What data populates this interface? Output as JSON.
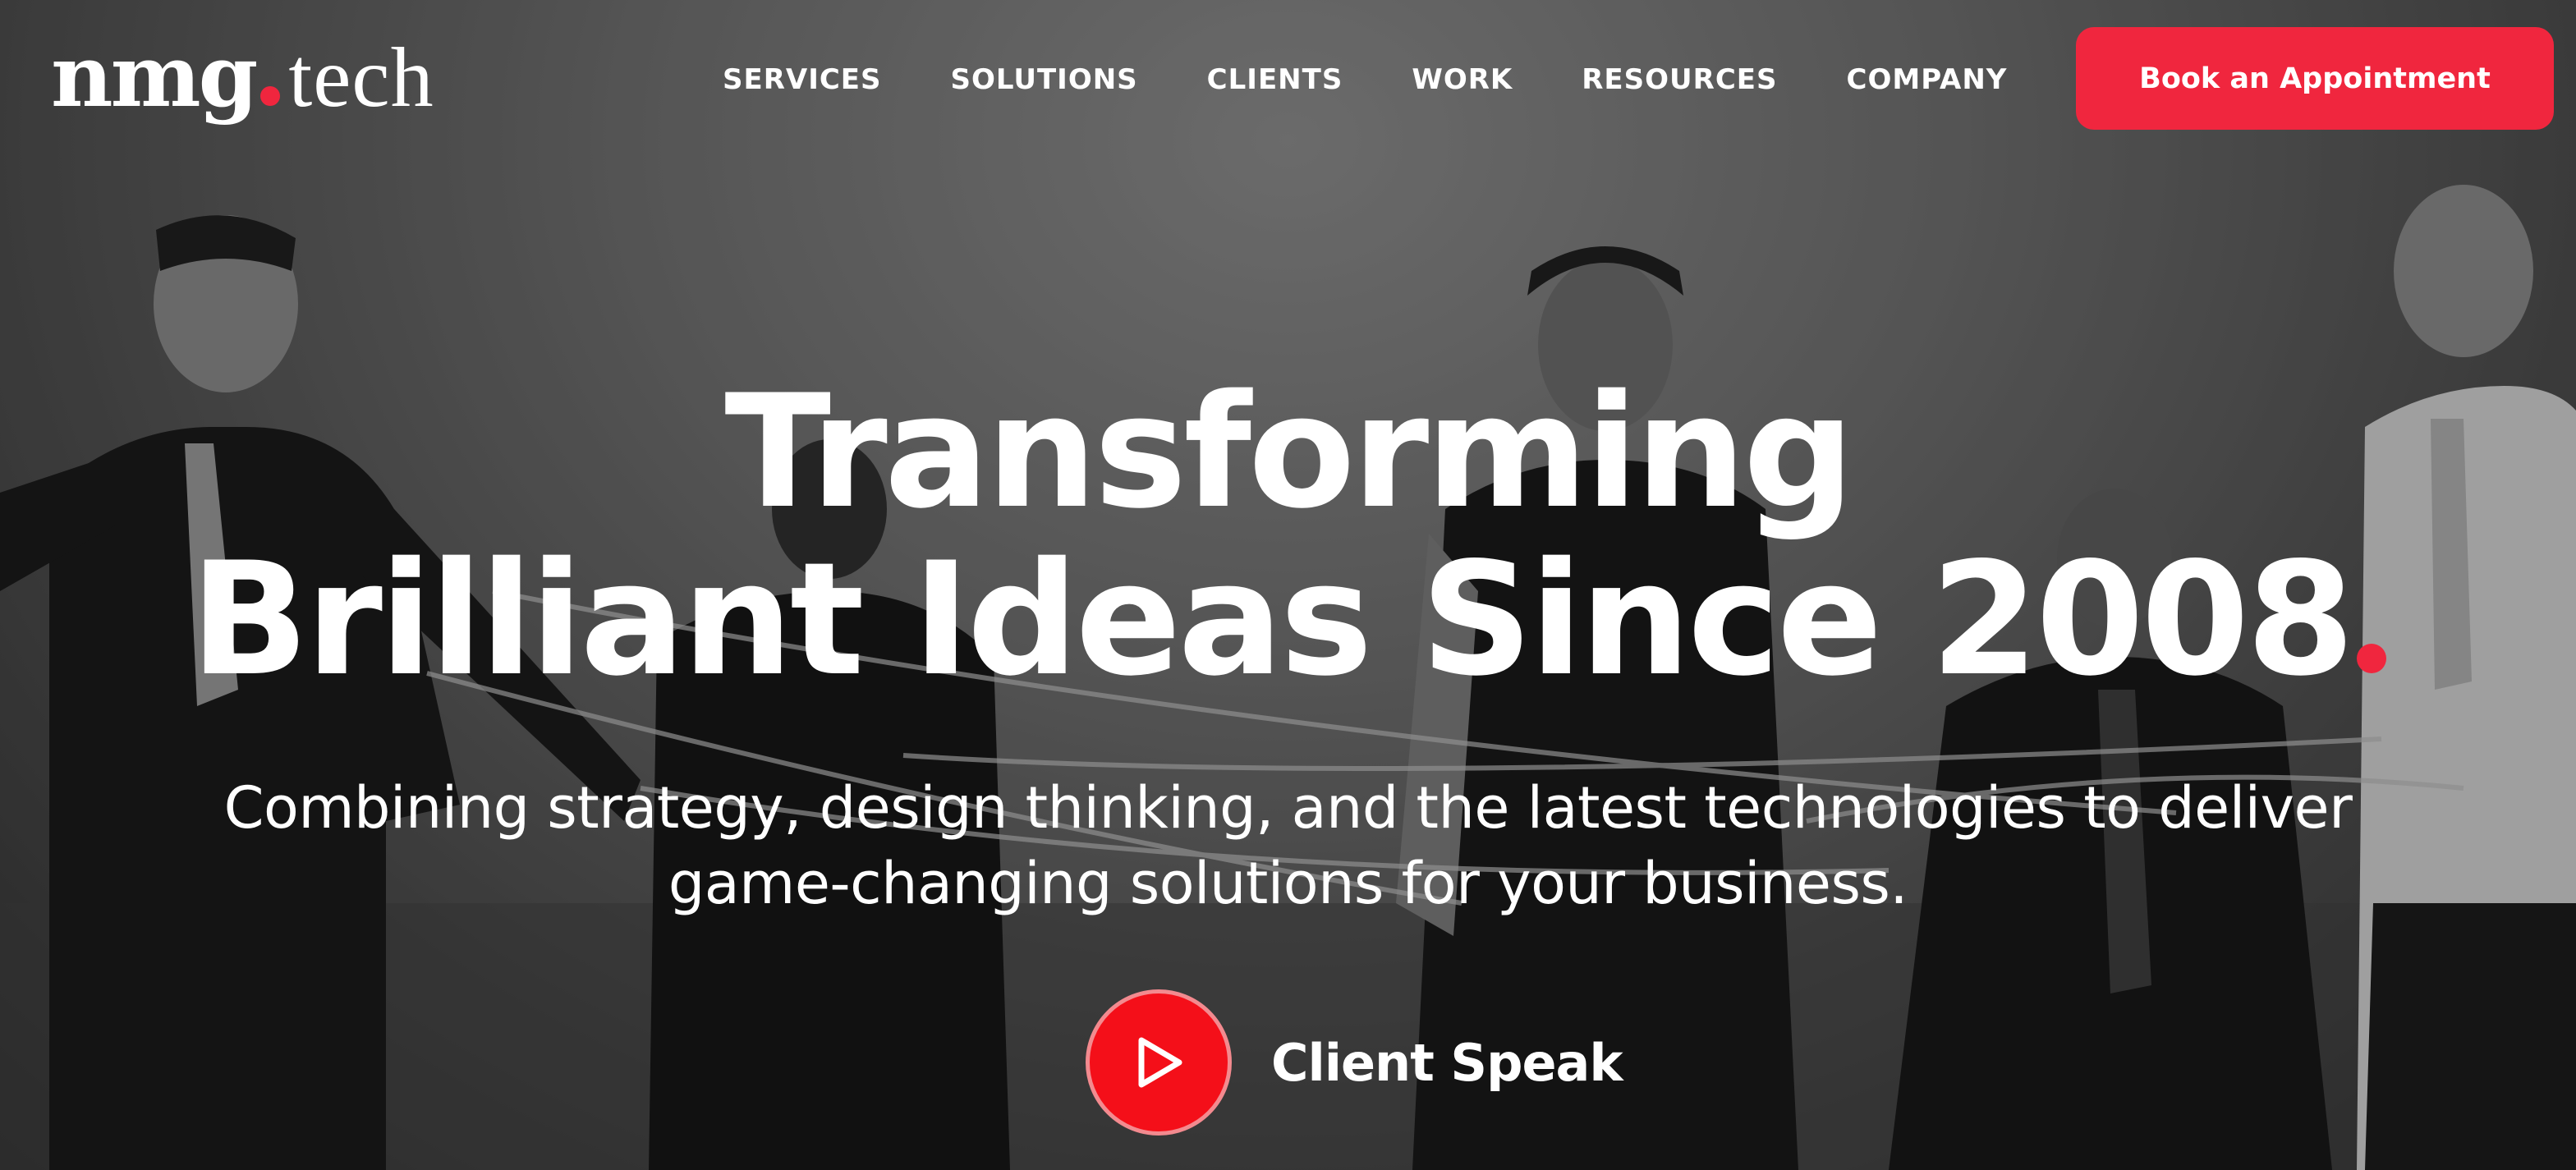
{
  "brand": {
    "logo_main": "nmg",
    "logo_sub": "tech",
    "accent_color": "#f0263e"
  },
  "nav": {
    "items": [
      {
        "label": "SERVICES"
      },
      {
        "label": "SOLUTIONS"
      },
      {
        "label": "CLIENTS"
      },
      {
        "label": "WORK"
      },
      {
        "label": "RESOURCES"
      },
      {
        "label": "COMPANY"
      }
    ],
    "cta_label": "Book an Appointment"
  },
  "hero": {
    "headline_line1": "Transforming",
    "headline_line2": "Brilliant Ideas Since 2008",
    "subheadline_line1": "Combining strategy, design thinking, and the latest technologies to deliver",
    "subheadline_line2": "game-changing solutions for your business.",
    "video_cta_label": "Client Speak",
    "video_cta_icon": "play-icon"
  }
}
